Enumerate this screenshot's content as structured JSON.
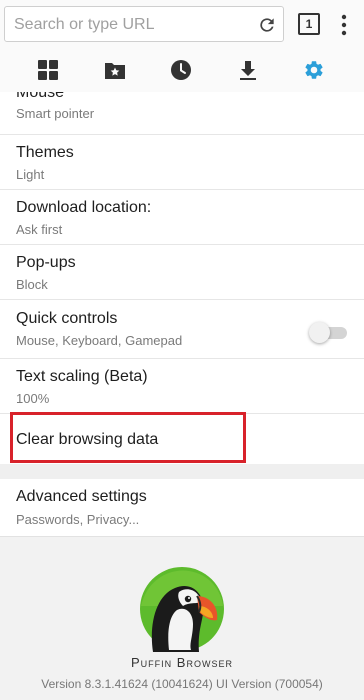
{
  "toolbar": {
    "url_placeholder": "Search or type URL",
    "tab_count": "1"
  },
  "icon_tabs": [
    "dashboard-icon",
    "bookmarks-folder-icon",
    "history-clock-icon",
    "download-icon",
    "settings-gear-icon"
  ],
  "colors": {
    "active_tab": "#2b9fd9",
    "highlight": "#d8222a"
  },
  "settings": {
    "mouse": {
      "title": "Mouse",
      "subtitle": "Smart pointer"
    },
    "themes": {
      "title": "Themes",
      "subtitle": "Light"
    },
    "download_location": {
      "title": "Download location:",
      "subtitle": "Ask first"
    },
    "popups": {
      "title": "Pop-ups",
      "subtitle": "Block"
    },
    "quick_controls": {
      "title": "Quick controls",
      "subtitle": "Mouse, Keyboard, Gamepad",
      "enabled": false
    },
    "text_scaling": {
      "title": "Text scaling (Beta)",
      "subtitle": "100%"
    },
    "clear_browsing": {
      "title": "Clear browsing data"
    },
    "advanced": {
      "title": "Advanced settings",
      "subtitle": "Passwords, Privacy..."
    }
  },
  "footer": {
    "brand": "Puffin Browser",
    "version": "Version 8.3.1.41624 (10041624) UI Version (700054)"
  }
}
